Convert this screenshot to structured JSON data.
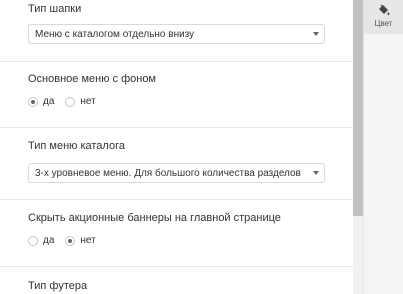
{
  "settings": {
    "header_type": {
      "label": "Тип шапки",
      "value": "Меню с каталогом отдельно внизу"
    },
    "main_menu_bg": {
      "label": "Основное меню с фоном",
      "options": [
        "да",
        "нет"
      ],
      "selected": "да"
    },
    "catalog_menu_type": {
      "label": "Тип меню каталога",
      "value": "3-х уровневое меню. Для большого количества разделов"
    },
    "hide_promo_banners": {
      "label": "Скрыть акционные баннеры на главной странице",
      "options": [
        "да",
        "нет"
      ],
      "selected": "нет"
    },
    "footer_type": {
      "label": "Тип футера"
    }
  },
  "right_rail": {
    "color_tab_label": "Цвет",
    "color_tab_icon": "paint-bucket-icon"
  },
  "colors": {
    "accent_rail_active": "#e6e6e6",
    "scrollbar_thumb": "#c1c1c1"
  }
}
